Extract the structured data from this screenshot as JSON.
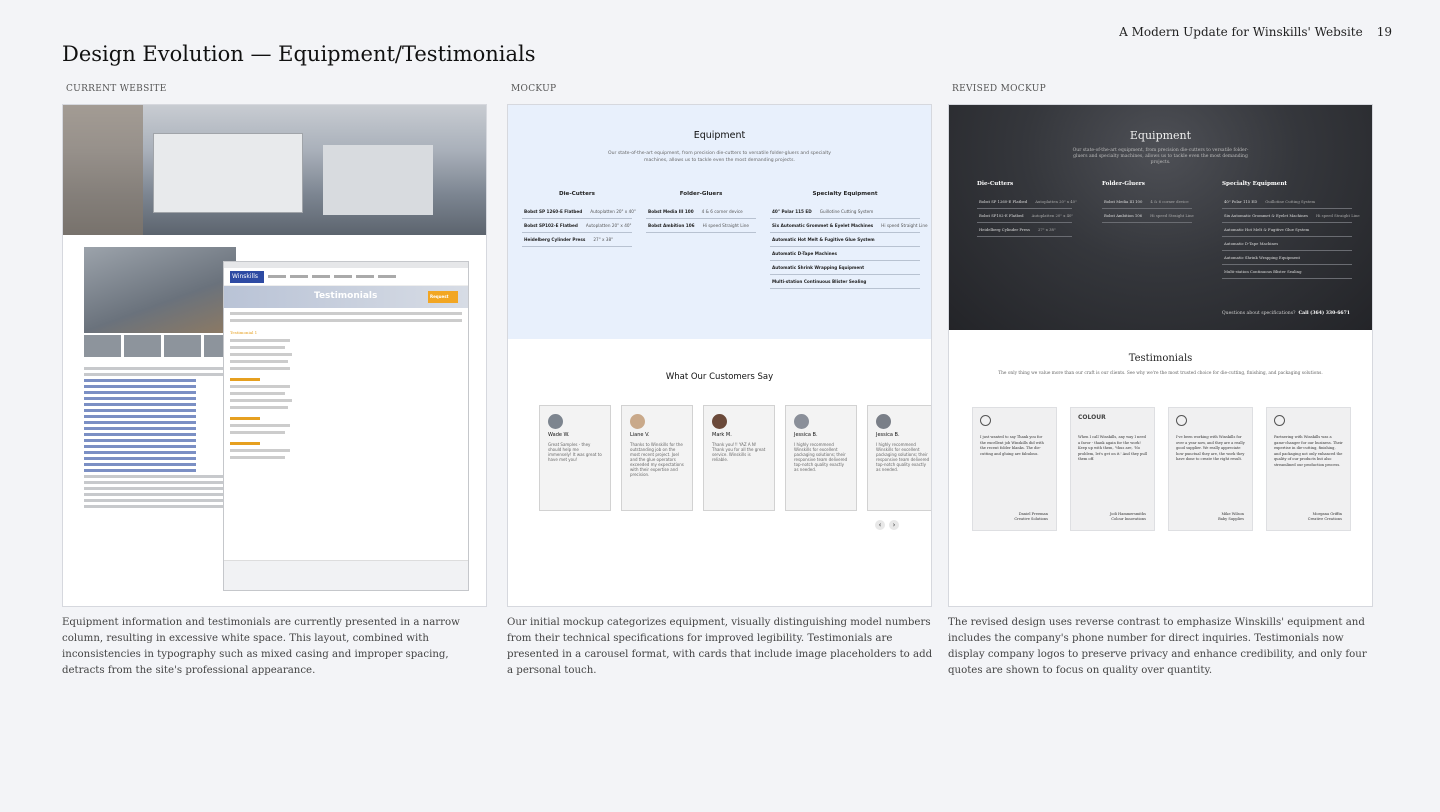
{
  "header": {
    "doc_title": "A Modern Update for Winskills' Website",
    "page_number": "19"
  },
  "page_title": "Design Evolution — Equipment/Testimonials",
  "columns": [
    {
      "label": "CURRENT WEBSITE",
      "caption": "Equipment information and testimonials are currently presented in a narrow column, resulting in excessive white space. This layout, combined with inconsistencies in typography such as mixed casing and improper spacing, detracts from the site's professional appearance.",
      "screenshot": {
        "logo": "Winskills",
        "hero": "Testimonials",
        "badge": "Request",
        "section": "Testimonial 1"
      }
    },
    {
      "label": "MOCKUP",
      "caption": "Our initial mockup categorizes equipment, visually distinguishing model numbers from their technical specifications for improved legibility. Testimonials are presented in a carousel format, with cards that include image placeholders to add a personal touch.",
      "equipment": {
        "title": "Equipment",
        "subtitle": "Our state-of-the-art equipment, from precision die-cutters to versatile folder-gluers and specialty machines, allows us to tackle even the most demanding projects.",
        "groups": [
          {
            "heading": "Die-Cutters",
            "rows": [
              {
                "k": "Bobst SP 1260-E Flatbed",
                "v": "Autoplatten 20\" x 40\""
              },
              {
                "k": "Bobst SP102-E Flatbed",
                "v": "Autoplatten 20\" x 40\""
              },
              {
                "k": "Heidelberg Cylinder Press",
                "v": "27\" x 38\""
              }
            ]
          },
          {
            "heading": "Folder-Gluers",
            "rows": [
              {
                "k": "Bobst Media III 100",
                "v": "4 & 6 corner device"
              },
              {
                "k": "Bobst Ambition 106",
                "v": "Hi speed Straight Line"
              }
            ]
          },
          {
            "heading": "Specialty Equipment",
            "rows": [
              {
                "k": "40\" Polar 115 ED",
                "v": "Guillotine Cutting System"
              },
              {
                "k": "Six Automatic Grommet & Eyelet Machines",
                "v": "Hi speed Straight Line"
              },
              {
                "k": "Automatic Hot Melt & Fugitive Glue System",
                "v": ""
              },
              {
                "k": "Automatic D-Tape Machines",
                "v": ""
              },
              {
                "k": "Automatic Shrink Wrapping Equipment",
                "v": ""
              },
              {
                "k": "Multi-station Continuous Blister Sealing",
                "v": ""
              }
            ]
          }
        ]
      },
      "testimonials": {
        "title": "What Our Customers Say",
        "cards": [
          {
            "name": "Wade W.",
            "text": "Great Samples - they should help me immensely! It was great to have met you!"
          },
          {
            "name": "Liane V.",
            "text": "Thanks to Winskills for the outstanding job on the most recent project. Joel and the glue operators exceeded my expectations with their expertise and precision."
          },
          {
            "name": "Mark M.",
            "text": "Thank you!!! YAZ A N! Thank you for all the great service. Winskills is reliable."
          },
          {
            "name": "Jessica B.",
            "text": "I highly recommend Winskills for excellent packaging solutions; their responsive team delivered top-notch quality exactly as needed."
          },
          {
            "name": "Jessica B.",
            "text": "I highly recommend Winskills for excellent packaging solutions; their responsive team delivered top-notch quality exactly as needed."
          }
        ]
      }
    },
    {
      "label": "REVISED MOCKUP",
      "caption": "The revised design uses reverse contrast to emphasize Winskills' equipment and includes the company's phone number for direct inquiries. Testimonials now display company logos to preserve privacy and enhance credibility, and only four quotes are shown to focus on quality over quantity.",
      "equipment": {
        "title": "Equipment",
        "subtitle": "Our state-of-the-art equipment, from precision die-cutters to versatile folder-gluers and specialty machines, allows us to tackle even the most demanding projects.",
        "groups": [
          {
            "heading": "Die-Cutters",
            "rows": [
              {
                "k": "Bobst SP 1260-E Flatbed",
                "v": "Autoplatten 20\" x 40\""
              },
              {
                "k": "Bobst SP102-E Flatbed",
                "v": "Autoplatten 20\" x 40\""
              },
              {
                "k": "Heidelberg Cylinder Press",
                "v": "27\" x 38\""
              }
            ]
          },
          {
            "heading": "Folder-Gluers",
            "rows": [
              {
                "k": "Bobst Media III 100",
                "v": "4 & 6 corner device"
              },
              {
                "k": "Bobst Ambition 106",
                "v": "Hi speed Straight Line"
              }
            ]
          },
          {
            "heading": "Specialty Equipment",
            "rows": [
              {
                "k": "40\" Polar 115 ED",
                "v": "Guillotine Cutting System"
              },
              {
                "k": "Six Automatic Grommet & Eyelet Machines",
                "v": "Hi speed Straight Line"
              },
              {
                "k": "Automatic Hot Melt & Fugitive Glue System",
                "v": ""
              },
              {
                "k": "Automatic D-Tape Machines",
                "v": ""
              },
              {
                "k": "Automatic Shrink Wrapping Equipment",
                "v": ""
              },
              {
                "k": "Multi-station Continuous Blister Sealing",
                "v": ""
              }
            ]
          }
        ],
        "phone_prompt": "Questions about specifications?",
        "phone": "Call (364) 330-6671"
      },
      "testimonials": {
        "title": "Testimonials",
        "subtitle": "The only thing we value more than our craft is our clients. See why we're the most trusted choice for die-cutting, finishing, and packaging solutions.",
        "cards": [
          {
            "logo": "",
            "text": "I just wanted to say Thank you for the excellent job Winskills did with the recent folder blanks. The die-cutting and gluing are fabulous.",
            "author": "Daniel Freeman",
            "company": "Creative Solutions"
          },
          {
            "logo": "COLOUR",
            "text": "When I call Winskills, any way I need a favor - thank again for the work! Keep up with them, \"thus are, 'No problem, let's get on it.' And they pull them off.",
            "author": "Jodi Hammersmiths",
            "company": "Colour Innovations"
          },
          {
            "logo": "",
            "text": "I've been working with Winskills for over a year now, and they are a really good supplier. We really appreciate how punctual they are, the work they have done to create the right result.",
            "author": "Mike Wilson",
            "company": "Baby Supplies"
          },
          {
            "logo": "",
            "text": "Partnering with Winskills was a game-changer for our business. Their expertise in die-cutting, finishing, and packaging not only enhanced the quality of our products but also streamlined our production process.",
            "author": "Morgana Griffin",
            "company": "Creative Creations"
          }
        ]
      }
    }
  ]
}
